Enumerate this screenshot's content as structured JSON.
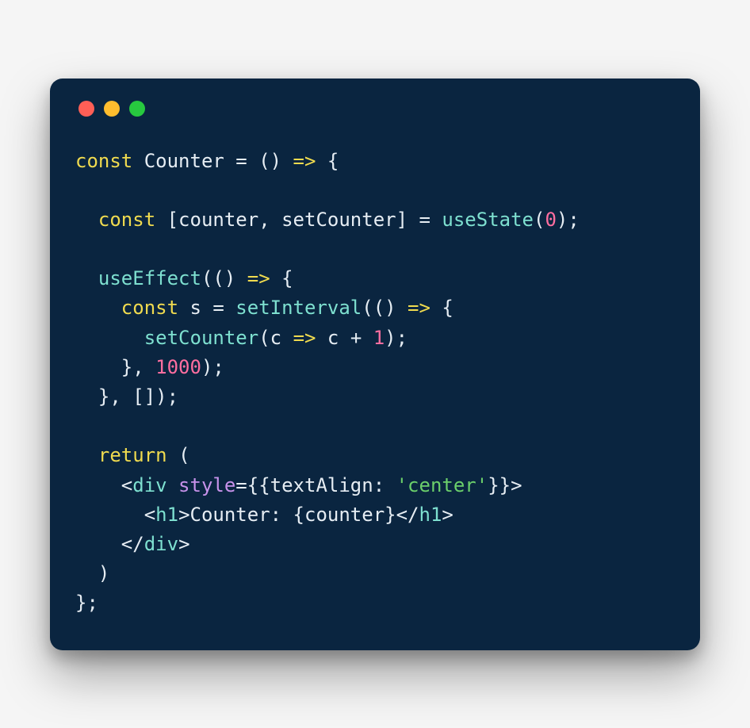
{
  "window": {
    "traffic_lights": [
      "red",
      "yellow",
      "green"
    ]
  },
  "code": {
    "tokens": [
      [
        {
          "t": "const ",
          "c": "keyword"
        },
        {
          "t": "Counter = () ",
          "c": "default"
        },
        {
          "t": "=>",
          "c": "keyword"
        },
        {
          "t": " {",
          "c": "default"
        }
      ],
      [],
      [
        {
          "t": "  ",
          "c": "default"
        },
        {
          "t": "const ",
          "c": "keyword"
        },
        {
          "t": "[counter, setCounter] = ",
          "c": "default"
        },
        {
          "t": "useState",
          "c": "fn"
        },
        {
          "t": "(",
          "c": "default"
        },
        {
          "t": "0",
          "c": "number"
        },
        {
          "t": ");",
          "c": "default"
        }
      ],
      [],
      [
        {
          "t": "  ",
          "c": "default"
        },
        {
          "t": "useEffect",
          "c": "fn"
        },
        {
          "t": "(() ",
          "c": "default"
        },
        {
          "t": "=>",
          "c": "keyword"
        },
        {
          "t": " {",
          "c": "default"
        }
      ],
      [
        {
          "t": "    ",
          "c": "default"
        },
        {
          "t": "const ",
          "c": "keyword"
        },
        {
          "t": "s = ",
          "c": "default"
        },
        {
          "t": "setInterval",
          "c": "fn"
        },
        {
          "t": "(() ",
          "c": "default"
        },
        {
          "t": "=>",
          "c": "keyword"
        },
        {
          "t": " {",
          "c": "default"
        }
      ],
      [
        {
          "t": "      ",
          "c": "default"
        },
        {
          "t": "setCounter",
          "c": "fn"
        },
        {
          "t": "(c ",
          "c": "default"
        },
        {
          "t": "=>",
          "c": "keyword"
        },
        {
          "t": " c + ",
          "c": "default"
        },
        {
          "t": "1",
          "c": "number"
        },
        {
          "t": ");",
          "c": "default"
        }
      ],
      [
        {
          "t": "    }, ",
          "c": "default"
        },
        {
          "t": "1000",
          "c": "number"
        },
        {
          "t": ");",
          "c": "default"
        }
      ],
      [
        {
          "t": "  }, []);",
          "c": "default"
        }
      ],
      [],
      [
        {
          "t": "  ",
          "c": "default"
        },
        {
          "t": "return ",
          "c": "keyword"
        },
        {
          "t": "(",
          "c": "default"
        }
      ],
      [
        {
          "t": "    <",
          "c": "default"
        },
        {
          "t": "div ",
          "c": "fn"
        },
        {
          "t": "style",
          "c": "attr"
        },
        {
          "t": "={{textAlign: ",
          "c": "default"
        },
        {
          "t": "'center'",
          "c": "string"
        },
        {
          "t": "}}>",
          "c": "default"
        }
      ],
      [
        {
          "t": "      <",
          "c": "default"
        },
        {
          "t": "h1",
          "c": "fn"
        },
        {
          "t": ">Counter: {counter}</",
          "c": "default"
        },
        {
          "t": "h1",
          "c": "fn"
        },
        {
          "t": ">",
          "c": "default"
        }
      ],
      [
        {
          "t": "    </",
          "c": "default"
        },
        {
          "t": "div",
          "c": "fn"
        },
        {
          "t": ">",
          "c": "default"
        }
      ],
      [
        {
          "t": "  )",
          "c": "default"
        }
      ],
      [
        {
          "t": "};",
          "c": "default"
        }
      ]
    ]
  }
}
